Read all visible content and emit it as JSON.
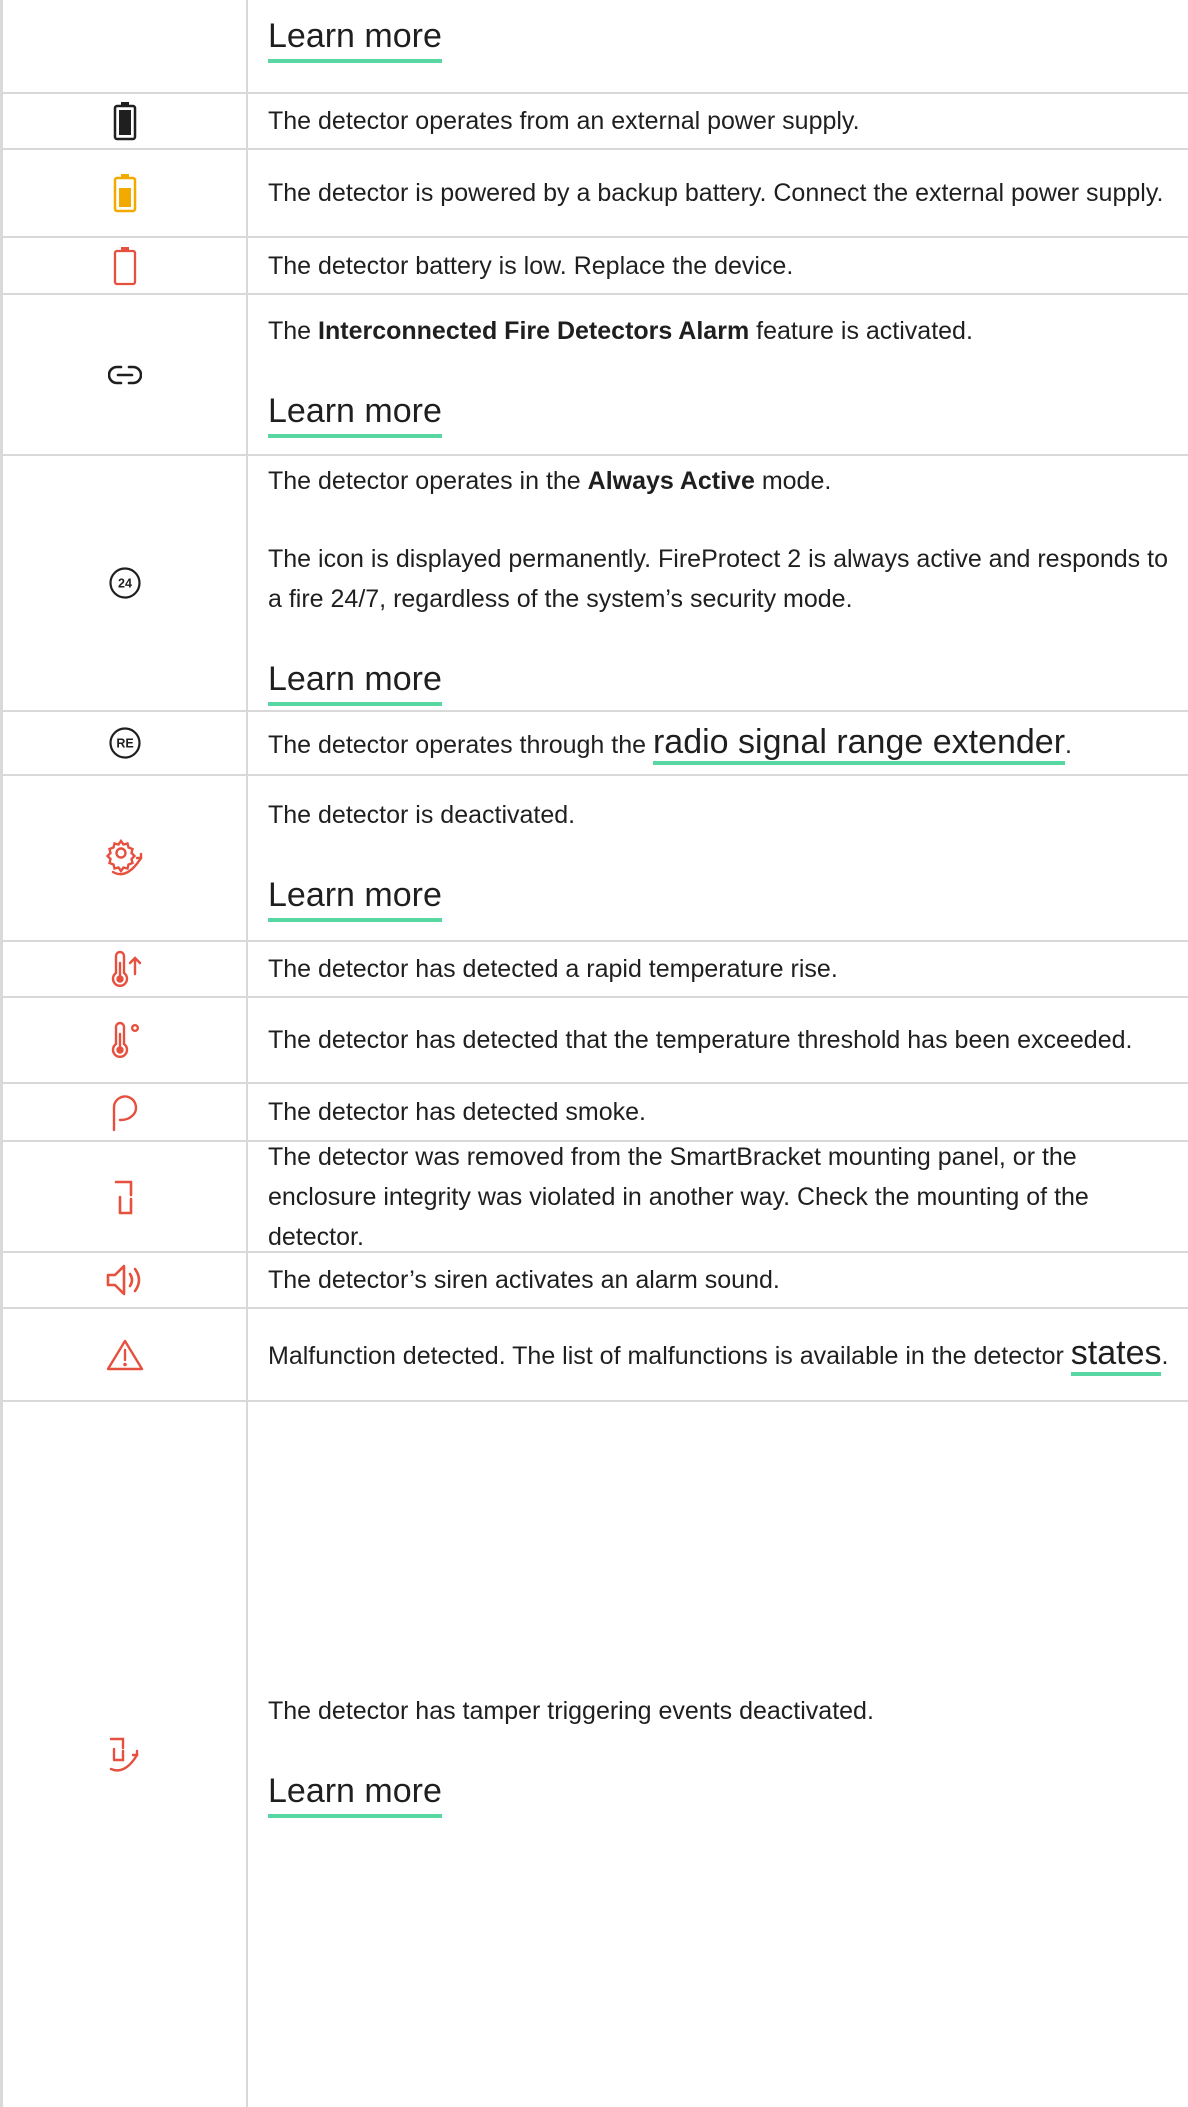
{
  "rows": [
    {
      "id": "r0",
      "icon": "none",
      "texts": [],
      "learn_more": "Learn more"
    },
    {
      "id": "r1",
      "icon": "battery-full-icon",
      "texts": [
        "The detector operates from an external power supply."
      ]
    },
    {
      "id": "r2",
      "icon": "battery-backup-icon",
      "texts": [
        "The detector is powered by a backup battery. Connect the external power supply."
      ]
    },
    {
      "id": "r3",
      "icon": "battery-low-icon",
      "texts": [
        "The detector battery is low. Replace the device."
      ]
    },
    {
      "id": "r4",
      "icon": "link-icon",
      "texts": [
        {
          "pre": "The ",
          "bold": "Interconnected Fire Detectors Alarm",
          "post": " feature is activated."
        }
      ],
      "learn_more": "Learn more"
    },
    {
      "id": "r5",
      "icon": "always-active-24-icon",
      "icon_text": "24",
      "texts": [
        {
          "pre": "The detector operates in the ",
          "bold": "Always Active",
          "post": " mode."
        },
        "The icon is displayed permanently. FireProtect 2 is always active and responds to a fire 24/7, regardless of the system’s security mode."
      ],
      "learn_more": "Learn more"
    },
    {
      "id": "r6",
      "icon": "range-extender-icon",
      "icon_text": "RE",
      "texts": [
        {
          "pre": "The detector operates through the ",
          "link": "radio signal range extender",
          "post": "."
        }
      ]
    },
    {
      "id": "r7",
      "icon": "device-deactivated-icon",
      "texts": [
        "The detector is deactivated."
      ],
      "learn_more": "Learn more"
    },
    {
      "id": "r8",
      "icon": "temperature-rise-icon",
      "texts": [
        "The detector has detected a rapid temperature rise."
      ]
    },
    {
      "id": "r9",
      "icon": "temperature-threshold-icon",
      "texts": [
        "The detector has detected that the temperature threshold has been exceeded."
      ]
    },
    {
      "id": "r10",
      "icon": "smoke-icon",
      "texts": [
        "The detector has detected smoke."
      ]
    },
    {
      "id": "r11",
      "icon": "tamper-icon",
      "texts": [
        "The detector was removed from the SmartBracket mounting panel, or the enclosure integrity was violated in another way. Check the mounting of the detector."
      ]
    },
    {
      "id": "r12",
      "icon": "siren-icon",
      "texts": [
        "The detector’s siren activates an alarm sound."
      ]
    },
    {
      "id": "r13",
      "icon": "malfunction-warning-icon",
      "texts": [
        {
          "pre": "Malfunction detected. The list of malfunctions is available in the detector ",
          "link": "states",
          "post": "."
        }
      ]
    },
    {
      "id": "r14",
      "icon": "tamper-deactivated-icon",
      "texts": [
        "The detector has tamper triggering events deactivated."
      ],
      "learn_more": "Learn more"
    }
  ],
  "colors": {
    "red": "#e5503f",
    "amber": "#f2a900",
    "dark": "#1f1f1f",
    "link_underline": "#59d7a3",
    "border": "#d9d9d9"
  }
}
